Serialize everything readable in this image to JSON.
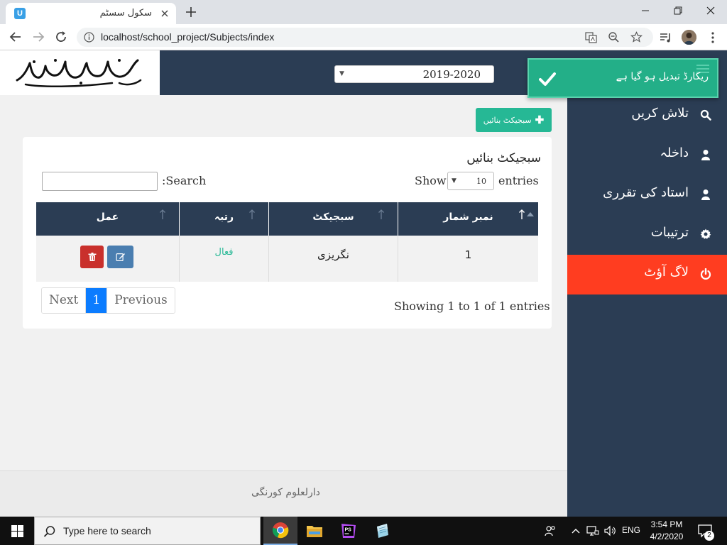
{
  "browser": {
    "tab_title": "سکول سسٹم",
    "favicon_letter": "U",
    "url": "localhost/school_project/Subjects/index"
  },
  "header": {
    "logo_alt": "جامعہ دارالعلوم کراچی",
    "year_selected": "2019-2020"
  },
  "notification": {
    "text": "ریکارڈ تبدیل ہو گیا ہے",
    "icon": "check-icon",
    "color": "#23af88"
  },
  "sidebar": {
    "items": [
      {
        "label": "تلاش کریں",
        "icon": "search-icon"
      },
      {
        "label": "داخلہ",
        "icon": "user-icon"
      },
      {
        "label": "استاد کی تقرری",
        "icon": "user-icon"
      },
      {
        "label": "ترتیبات",
        "icon": "gear-icon"
      },
      {
        "label": "لاگ آؤٹ",
        "icon": "power-icon"
      }
    ],
    "logout_color": "#ff3d20",
    "bg_color": "#2b3d54"
  },
  "main": {
    "create_button_label": "سبجیکٹ بنائیں",
    "card_title": "سبجیکٹ بنائیں",
    "length_label_show": "Show",
    "length_value": "10",
    "length_label_entries": "entries",
    "search_label": ":Search",
    "search_value": "",
    "table": {
      "columns": [
        "نمبر شمار",
        "سبجیکٹ",
        "رتبہ",
        "عمل"
      ],
      "rows": [
        {
          "serial": "1",
          "subject": "نگریزی",
          "status": "فعال"
        }
      ]
    },
    "pagination": {
      "next_label": "Next",
      "current_page": "1",
      "previous_label": "Previous"
    },
    "info": "Showing 1 to 1 of 1 entries"
  },
  "footer": {
    "text": "دارلعلوم کورنگی"
  },
  "taskbar": {
    "search_placeholder": "Type here to search",
    "language": "ENG",
    "time": "3:54 PM",
    "date": "4/2/2020",
    "notification_count": "2"
  }
}
